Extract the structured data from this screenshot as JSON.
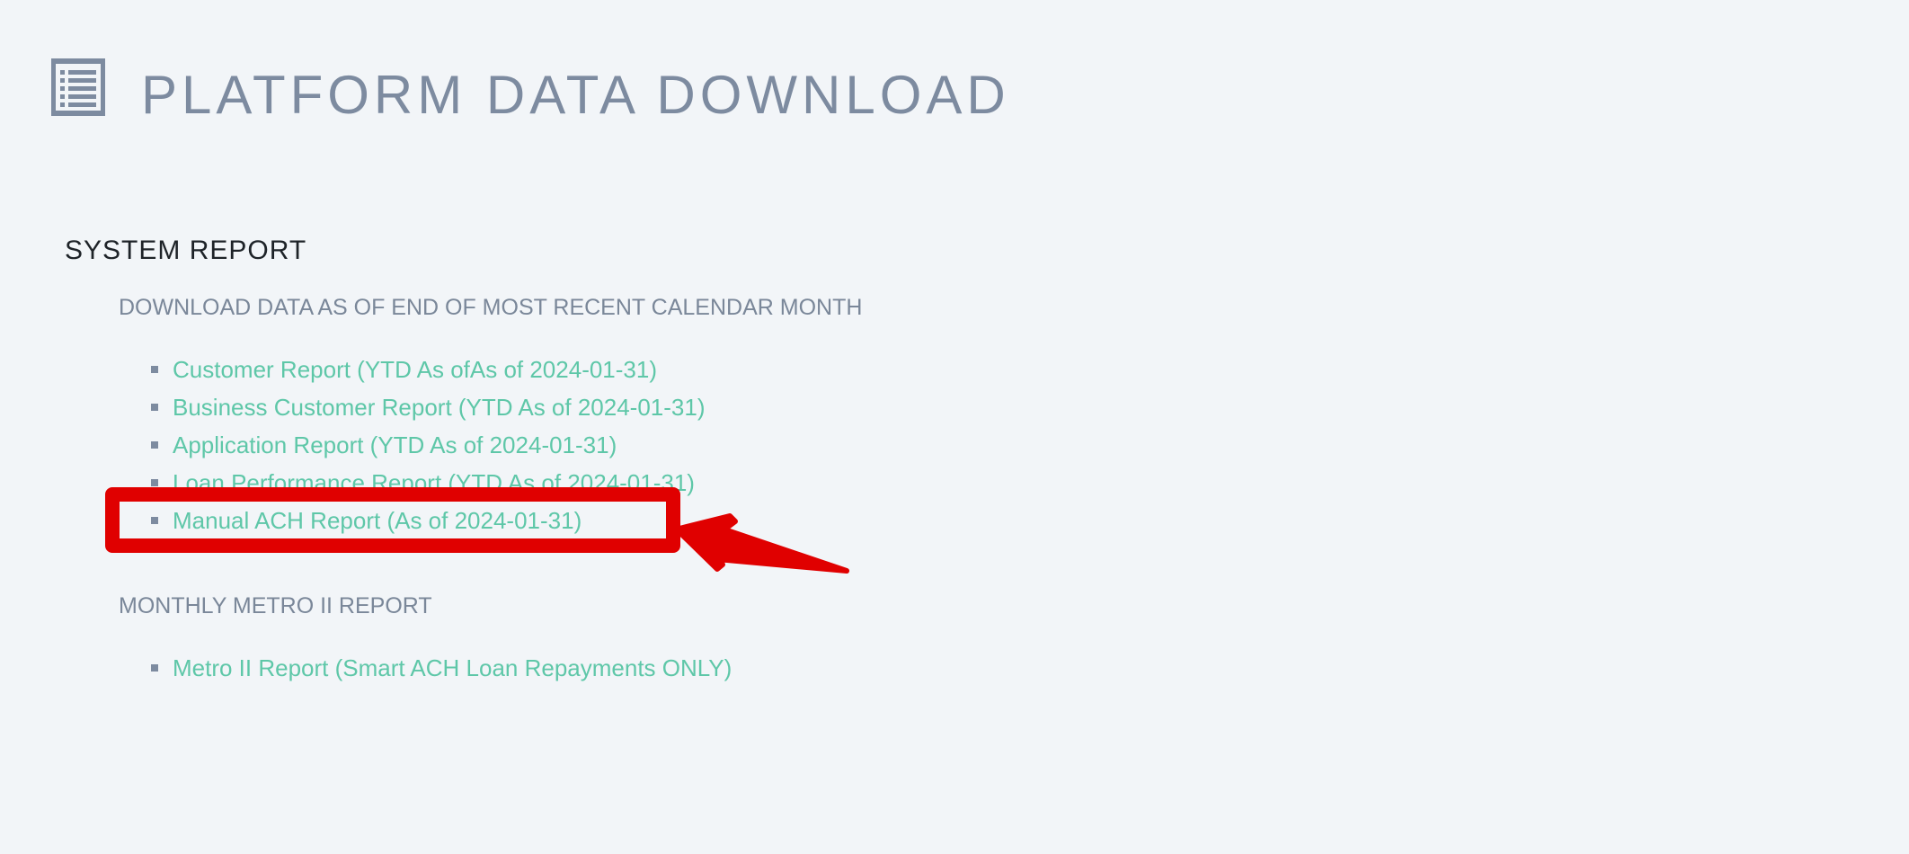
{
  "header": {
    "icon": "list-icon",
    "title": "PLATFORM DATA DOWNLOAD"
  },
  "section": {
    "title": "SYSTEM REPORT"
  },
  "groups": [
    {
      "title": "DOWNLOAD DATA AS OF END OF MOST RECENT CALENDAR MONTH",
      "reports": [
        {
          "label": "Customer Report (YTD As ofAs of 2024-01-31)"
        },
        {
          "label": "Business Customer Report (YTD As of 2024-01-31)"
        },
        {
          "label": "Application Report (YTD As of 2024-01-31)"
        },
        {
          "label": "Loan Performance Report (YTD As of 2024-01-31)"
        },
        {
          "label": "Manual ACH Report (As of 2024-01-31)"
        }
      ]
    },
    {
      "title": "MONTHLY METRO II REPORT",
      "reports": [
        {
          "label": "Metro II Report (Smart ACH Loan Repayments ONLY)"
        }
      ]
    }
  ],
  "colors": {
    "background": "#f2f5f8",
    "title": "#7d8ba0",
    "link": "#5ec7a8",
    "highlight": "#e00000"
  }
}
